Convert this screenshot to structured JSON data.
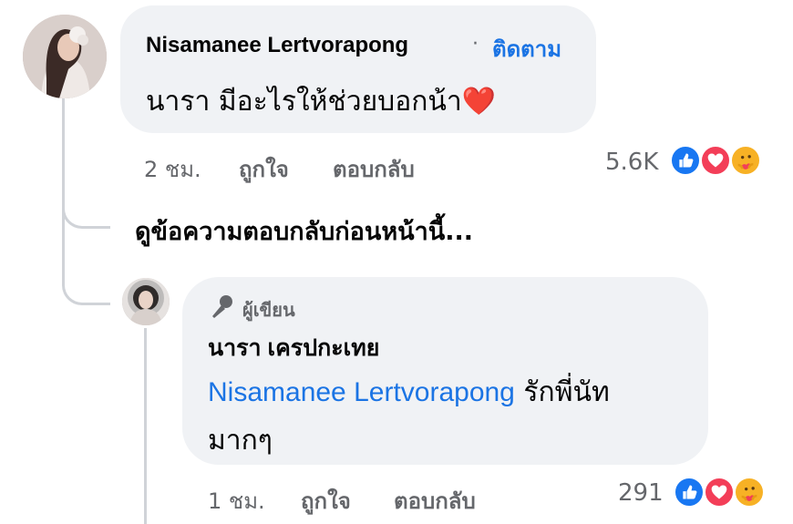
{
  "comment": {
    "author": "Nisamanee Lertvorapong",
    "separator": "·",
    "follow_label": "ติดตาม",
    "text": "นารา มีอะไรให้ช่วยบอกน้า",
    "emoji": "❤️",
    "time": "2 ชม.",
    "like_label": "ถูกใจ",
    "reply_label": "ตอบกลับ",
    "reaction_count": "5.6K"
  },
  "view_previous": "ดูข้อความตอบกลับก่อนหน้านี้...",
  "reply": {
    "author_badge": "ผู้เขียน",
    "author": "นารา เครปกะเทย",
    "mention": "Nisamanee Lertvorapong",
    "text_line1": "รักพี่นัท",
    "text_line2": "มากๆ",
    "time": "1 ชม.",
    "like_label": "ถูกใจ",
    "reply_label": "ตอบกลับ",
    "reaction_count": "291"
  },
  "icons": {
    "like": "like-reaction-icon",
    "love": "love-reaction-icon",
    "care": "care-reaction-icon",
    "author": "microphone-icon"
  },
  "colors": {
    "accent": "#1b74e4",
    "like": "#1877f2",
    "love": "#f33e58",
    "care": "#f7b125",
    "bubble": "#f0f2f5",
    "muted": "#65676b"
  }
}
